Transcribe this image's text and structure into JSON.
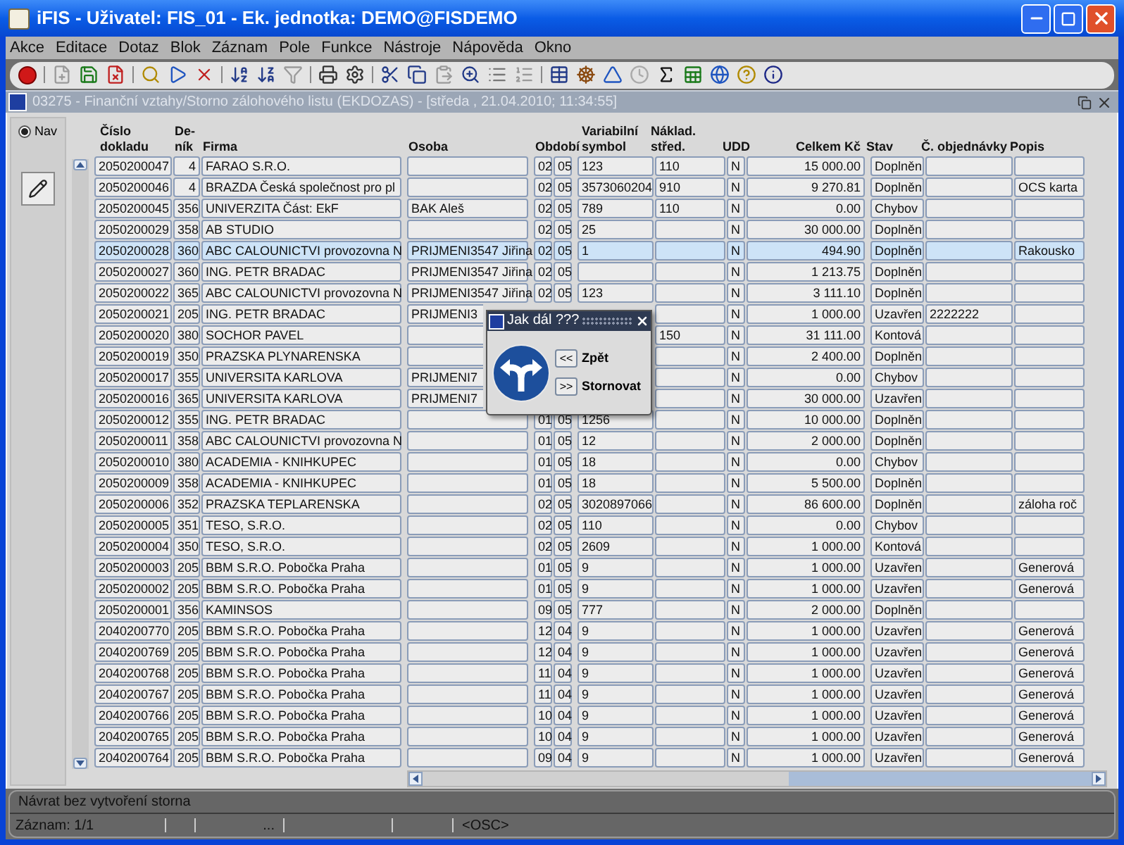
{
  "window": {
    "title": "iFIS - Uživatel: FIS_01 - Ek. jednotka: DEMO@FISDEMO"
  },
  "menu": [
    "Akce",
    "Editace",
    "Dotaz",
    "Blok",
    "Záznam",
    "Pole",
    "Funkce",
    "Nástroje",
    "Nápověda",
    "Okno"
  ],
  "form": {
    "title": "03275 - Finanční vztahy/Storno zálohového listu (EKDOZAS) - [středa , 21.04.2010; 11:34:55]",
    "nav": {
      "label": "Nav",
      "checked": true
    }
  },
  "columns": [
    "Číslo\ndokladu",
    "De-\nník",
    "Firma",
    "Osoba",
    "Období",
    "Variabilní\nsymbol",
    "Náklad.\nstřed.",
    "UDD",
    "Celkem Kč",
    "Stav",
    "Č. objednávky",
    "Popis"
  ],
  "rows": [
    {
      "number": "2050200047",
      "journal": "4",
      "firm": "FARAO S.R.O.",
      "month": "02",
      "year": "05",
      "var_symbol": "123",
      "cost_center": "110",
      "udd": "N",
      "total": "15 000.00",
      "status": "Doplněn",
      "selected": false
    },
    {
      "number": "2050200046",
      "journal": "4",
      "firm": "BRAZDA Česká společnost pro pl",
      "month": "02",
      "year": "05",
      "var_symbol": "3573060204",
      "cost_center": "910",
      "udd": "N",
      "total": "9 270.81",
      "status": "Doplněn",
      "description": "OCS karta",
      "selected": false
    },
    {
      "number": "2050200045",
      "journal": "356",
      "firm": "UNIVERZITA Část: EkF",
      "person": "BAK Aleš",
      "month": "02",
      "year": "05",
      "var_symbol": "789",
      "cost_center": "110",
      "udd": "N",
      "total": "0.00",
      "status": "Chybov",
      "selected": false
    },
    {
      "number": "2050200029",
      "journal": "358",
      "firm": "AB STUDIO",
      "month": "02",
      "year": "05",
      "var_symbol": "25",
      "udd": "N",
      "total": "30 000.00",
      "status": "Doplněn",
      "selected": false
    },
    {
      "number": "2050200028",
      "journal": "360",
      "firm": "ABC CALOUNICTVI provozovna N",
      "person": "PRIJMENI3547 Jiřina",
      "month": "02",
      "year": "05",
      "var_symbol": "1",
      "udd": "N",
      "total": "494.90",
      "status": "Doplněn",
      "description": "Rakousko",
      "selected": true
    },
    {
      "number": "2050200027",
      "journal": "360",
      "firm": "ING. PETR BRADAC",
      "person": "PRIJMENI3547 Jiřina",
      "month": "02",
      "year": "05",
      "udd": "N",
      "total": "1 213.75",
      "status": "Doplněn",
      "selected": false
    },
    {
      "number": "2050200022",
      "journal": "365",
      "firm": "ABC CALOUNICTVI provozovna N",
      "person": "PRIJMENI3547 Jiřina",
      "month": "02",
      "year": "05",
      "var_symbol": "123",
      "udd": "N",
      "total": "3 111.10",
      "status": "Doplněn",
      "selected": false
    },
    {
      "number": "2050200021",
      "journal": "205",
      "firm": "ING. PETR BRADAC",
      "person": "PRIJMENI3",
      "under_dialog": true,
      "udd": "N",
      "total": "1 000.00",
      "status": "Uzavřen",
      "order_no": "2222222",
      "selected": false
    },
    {
      "number": "2050200020",
      "journal": "380",
      "firm": "SOCHOR PAVEL",
      "under_dialog": true,
      "cost_center": "150",
      "udd": "N",
      "total": "31 111.00",
      "status": "Kontová",
      "selected": false
    },
    {
      "number": "2050200019",
      "journal": "350",
      "firm": "PRAZSKA PLYNARENSKA",
      "under_dialog": true,
      "udd": "N",
      "total": "2 400.00",
      "status": "Doplněn",
      "selected": false
    },
    {
      "number": "2050200017",
      "journal": "355",
      "firm": "UNIVERSITA KARLOVA",
      "under_dialog": true,
      "person": "PRIJMENI7",
      "udd": "N",
      "total": "0.00",
      "status": "Chybov",
      "selected": false
    },
    {
      "number": "2050200016",
      "journal": "365",
      "firm": "UNIVERSITA KARLOVA",
      "under_dialog": true,
      "person": "PRIJMENI7",
      "udd": "N",
      "total": "30 000.00",
      "status": "Uzavřen",
      "selected": false
    },
    {
      "number": "2050200012",
      "journal": "355",
      "firm": "ING. PETR BRADAC",
      "month": "01",
      "year": "05",
      "var_symbol": "1256",
      "udd": "N",
      "total": "10 000.00",
      "status": "Doplněn",
      "selected": false
    },
    {
      "number": "2050200011",
      "journal": "358",
      "firm": "ABC CALOUNICTVI provozovna N",
      "month": "01",
      "year": "05",
      "var_symbol": "12",
      "udd": "N",
      "total": "2 000.00",
      "status": "Doplněn",
      "selected": false
    },
    {
      "number": "2050200010",
      "journal": "380",
      "firm": "ACADEMIA - KNIHKUPEC",
      "month": "01",
      "year": "05",
      "var_symbol": "18",
      "udd": "N",
      "total": "0.00",
      "status": "Chybov",
      "selected": false
    },
    {
      "number": "2050200009",
      "journal": "358",
      "firm": "ACADEMIA - KNIHKUPEC",
      "month": "01",
      "year": "05",
      "var_symbol": "18",
      "udd": "N",
      "total": "5 500.00",
      "status": "Doplněn",
      "selected": false
    },
    {
      "number": "2050200006",
      "journal": "352",
      "firm": "PRAZSKA TEPLARENSKA",
      "month": "02",
      "year": "05",
      "var_symbol": "3020897066",
      "udd": "N",
      "total": "86 600.00",
      "status": "Doplněn",
      "description": "záloha roč",
      "selected": false
    },
    {
      "number": "2050200005",
      "journal": "351",
      "firm": "TESO, S.R.O.",
      "month": "02",
      "year": "05",
      "var_symbol": "110",
      "udd": "N",
      "total": "0.00",
      "status": "Chybov",
      "selected": false
    },
    {
      "number": "2050200004",
      "journal": "350",
      "firm": "TESO, S.R.O.",
      "month": "02",
      "year": "05",
      "var_symbol": "2609",
      "udd": "N",
      "total": "1 000.00",
      "status": "Kontová",
      "selected": false
    },
    {
      "number": "2050200003",
      "journal": "205",
      "firm": "BBM S.R.O. Pobočka Praha",
      "month": "01",
      "year": "05",
      "var_symbol": "9",
      "udd": "N",
      "total": "1 000.00",
      "status": "Uzavřen",
      "description": "Generová",
      "selected": false
    },
    {
      "number": "2050200002",
      "journal": "205",
      "firm": "BBM S.R.O. Pobočka Praha",
      "month": "01",
      "year": "05",
      "var_symbol": "9",
      "udd": "N",
      "total": "1 000.00",
      "status": "Uzavřen",
      "description": "Generová",
      "selected": false
    },
    {
      "number": "2050200001",
      "journal": "356",
      "firm": "KAMINSOS",
      "month": "09",
      "year": "05",
      "var_symbol": "777",
      "udd": "N",
      "total": "2 000.00",
      "status": "Doplněn",
      "selected": false
    },
    {
      "number": "2040200770",
      "journal": "205",
      "firm": "BBM S.R.O. Pobočka Praha",
      "month": "12",
      "year": "04",
      "var_symbol": "9",
      "udd": "N",
      "total": "1 000.00",
      "status": "Uzavřen",
      "description": "Generová",
      "selected": false
    },
    {
      "number": "2040200769",
      "journal": "205",
      "firm": "BBM S.R.O. Pobočka Praha",
      "month": "12",
      "year": "04",
      "var_symbol": "9",
      "udd": "N",
      "total": "1 000.00",
      "status": "Uzavřen",
      "description": "Generová",
      "selected": false
    },
    {
      "number": "2040200768",
      "journal": "205",
      "firm": "BBM S.R.O. Pobočka Praha",
      "month": "11",
      "year": "04",
      "var_symbol": "9",
      "udd": "N",
      "total": "1 000.00",
      "status": "Uzavřen",
      "description": "Generová",
      "selected": false
    },
    {
      "number": "2040200767",
      "journal": "205",
      "firm": "BBM S.R.O. Pobočka Praha",
      "month": "11",
      "year": "04",
      "var_symbol": "9",
      "udd": "N",
      "total": "1 000.00",
      "status": "Uzavřen",
      "description": "Generová",
      "selected": false
    },
    {
      "number": "2040200766",
      "journal": "205",
      "firm": "BBM S.R.O. Pobočka Praha",
      "month": "10",
      "year": "04",
      "var_symbol": "9",
      "udd": "N",
      "total": "1 000.00",
      "status": "Uzavřen",
      "description": "Generová",
      "selected": false
    },
    {
      "number": "2040200765",
      "journal": "205",
      "firm": "BBM S.R.O. Pobočka Praha",
      "month": "10",
      "year": "04",
      "var_symbol": "9",
      "udd": "N",
      "total": "1 000.00",
      "status": "Uzavřen",
      "description": "Generová",
      "selected": false
    },
    {
      "number": "2040200764",
      "journal": "205",
      "firm": "BBM S.R.O. Pobočka Praha",
      "month": "09",
      "year": "04",
      "var_symbol": "9",
      "udd": "N",
      "total": "1 000.00",
      "status": "Uzavřen",
      "description": "Generová",
      "selected": false
    }
  ],
  "dialog": {
    "title": "Jak dál ???",
    "buttons": [
      {
        "key": "<<",
        "label": "Zpět"
      },
      {
        "key": ">>",
        "label": "Stornovat"
      }
    ]
  },
  "status_bar": {
    "message": "Návrat bez vytvoření storna",
    "record": "Záznam: 1/1",
    "field_3": "...",
    "mode": "<OSC>"
  }
}
